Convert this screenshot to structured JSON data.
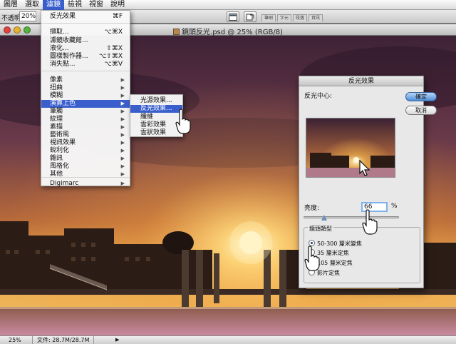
{
  "menubar": {
    "items": [
      {
        "label": "圖層",
        "active": false
      },
      {
        "label": "選取",
        "active": false
      },
      {
        "label": "濾鏡",
        "active": true
      },
      {
        "label": "檢視",
        "active": false
      },
      {
        "label": "視窗",
        "active": false
      },
      {
        "label": "說明",
        "active": false
      }
    ]
  },
  "options": {
    "opacity_label": "不透明:",
    "opacity_value": "20%",
    "panel_tabs": [
      "筆刷",
      "字元",
      "段落",
      "資訊"
    ]
  },
  "document": {
    "title": "鏡頭反光.psd @ 25% (RGB/8)",
    "zoom": "25%",
    "file_info": "文件: 28.7M/28.7M",
    "status_arrow": "▶"
  },
  "filter_menu": {
    "items": [
      {
        "label": "反光效果",
        "shortcut": "⌘F",
        "sub": false
      },
      {
        "label": "擷取...",
        "shortcut": "⌥⌘X",
        "sub": false
      },
      {
        "label": "濾鏡收藏館...",
        "shortcut": "",
        "sub": false
      },
      {
        "label": "液化...",
        "shortcut": "⇧⌘X",
        "sub": false
      },
      {
        "label": "圖樣製作器...",
        "shortcut": "⌥⇧⌘X",
        "sub": false
      },
      {
        "label": "消失點...",
        "shortcut": "⌥⌘V",
        "sub": false
      },
      {
        "label": "像素",
        "shortcut": "",
        "sub": true
      },
      {
        "label": "扭曲",
        "shortcut": "",
        "sub": true
      },
      {
        "label": "模糊",
        "shortcut": "",
        "sub": true
      },
      {
        "label": "演算上色",
        "shortcut": "",
        "sub": true,
        "highlighted": true
      },
      {
        "label": "筆觸",
        "shortcut": "",
        "sub": true
      },
      {
        "label": "紋理",
        "shortcut": "",
        "sub": true
      },
      {
        "label": "素描",
        "shortcut": "",
        "sub": true
      },
      {
        "label": "藝術風",
        "shortcut": "",
        "sub": true
      },
      {
        "label": "視訊效果",
        "shortcut": "",
        "sub": true
      },
      {
        "label": "銳利化",
        "shortcut": "",
        "sub": true
      },
      {
        "label": "雜訊",
        "shortcut": "",
        "sub": true
      },
      {
        "label": "風格化",
        "shortcut": "",
        "sub": true
      },
      {
        "label": "其他",
        "shortcut": "",
        "sub": true
      },
      {
        "label": "Digimarc",
        "shortcut": "",
        "sub": true
      }
    ],
    "submenu_arrow": "▶"
  },
  "render_submenu": {
    "items": [
      {
        "label": "光源效果...",
        "highlighted": false
      },
      {
        "label": "反光效果...",
        "highlighted": true
      },
      {
        "label": "纖維",
        "highlighted": false
      },
      {
        "label": "雲彩效果",
        "highlighted": false
      },
      {
        "label": "雲狀效果",
        "highlighted": false
      }
    ]
  },
  "dialog": {
    "title": "反光效果",
    "center_label": "反光中心:",
    "ok_label": "確定",
    "cancel_label": "取消",
    "brightness_label": "亮度:",
    "brightness_value": "66",
    "brightness_fraction": 0.22,
    "percent_sign": "%",
    "lens_group_title": "鏡頭類型",
    "lens_options": [
      {
        "label": "50-300 釐米變焦",
        "selected": true
      },
      {
        "label": "35 釐米定焦",
        "selected": false
      },
      {
        "label": "105 釐米定焦",
        "selected": false
      },
      {
        "label": "影片定焦",
        "selected": false
      }
    ]
  },
  "colors": {
    "menu_highlight": "#3a5fcd",
    "sky_top": "#4a2740",
    "sun": "#fff3c4"
  }
}
